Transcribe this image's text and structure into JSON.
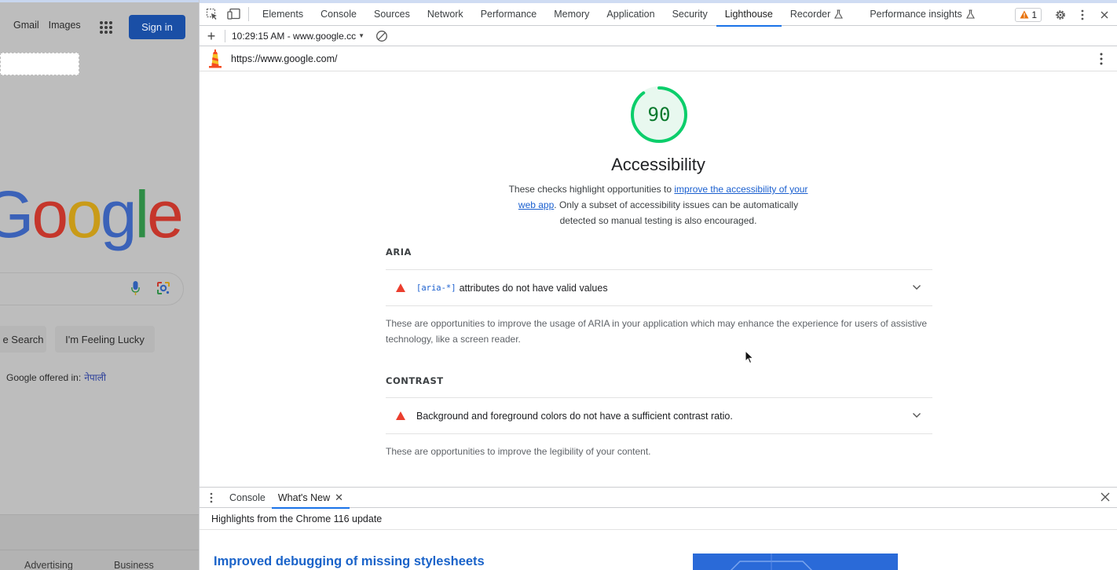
{
  "google_page": {
    "gmail": "Gmail",
    "images": "Images",
    "sign_in": "Sign in",
    "logo_parts": [
      "G",
      "o",
      "o",
      "g",
      "l",
      "e"
    ],
    "search_button": "Google Search",
    "search_button_visible": "e Search",
    "lucky_button": "I'm Feeling Lucky",
    "offered_in": "Google offered in:",
    "language": "नेपाली",
    "footer_left": "Advertising",
    "footer_right": "Business"
  },
  "devtools": {
    "tabs": [
      "Elements",
      "Console",
      "Sources",
      "Network",
      "Performance",
      "Memory",
      "Application",
      "Security",
      "Lighthouse",
      "Recorder",
      "Performance insights"
    ],
    "active_tab": "Lighthouse",
    "warning_count": "1",
    "report_selector": "10:29:15 AM - www.google.cc",
    "url": "https://www.google.com/"
  },
  "report": {
    "score": "90",
    "score_color": "#0cce6b",
    "category": "Accessibility",
    "desc_before": "These checks highlight opportunities to ",
    "desc_link": "improve the accessibility of your web app",
    "desc_after": ". Only a subset of accessibility issues can be automatically detected so manual testing is also encouraged.",
    "groups": [
      {
        "title": "ARIA",
        "audit_code": "[aria-*]",
        "audit_label": "attributes do not have valid values",
        "description": "These are opportunities to improve the usage of ARIA in your application which may enhance the experience for users of assistive technology, like a screen reader."
      },
      {
        "title": "CONTRAST",
        "audit_code": "",
        "audit_label": "Background and foreground colors do not have a sufficient contrast ratio.",
        "description": "These are opportunities to improve the legibility of your content."
      }
    ]
  },
  "drawer": {
    "tabs": [
      "Console",
      "What's New"
    ],
    "active_tab": "What's New",
    "subtitle": "Highlights from the Chrome 116 update",
    "headline": "Improved debugging of missing stylesheets"
  }
}
